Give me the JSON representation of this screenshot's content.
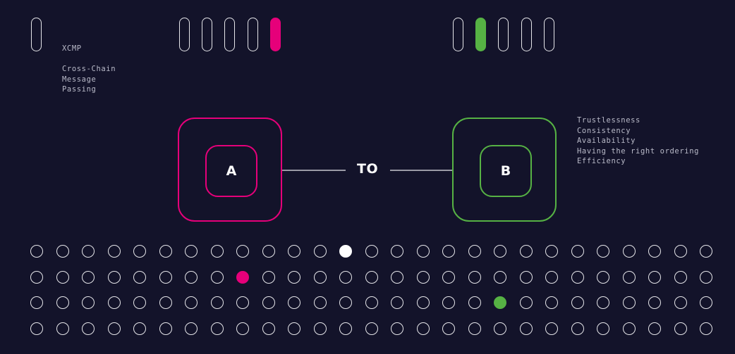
{
  "xcmp": {
    "title": "XCMP",
    "subtitle_lines": "Cross-Chain\nMessage\nPassing"
  },
  "properties": {
    "lines": "Trustlessness\nConsistency\nAvailability\nHaving the right ordering\nEfficiency"
  },
  "diagram": {
    "source_label": "A",
    "connector_label": "TO",
    "target_label": "B"
  },
  "pill_groups": {
    "left_single_count": 1,
    "source_group": {
      "count": 5,
      "highlighted_index": 4
    },
    "target_group": {
      "count": 5,
      "highlighted_index": 1
    }
  },
  "dot_grid": {
    "rows": 4,
    "columns": 27,
    "highlights": [
      {
        "row": 0,
        "col": 12,
        "color": "white"
      },
      {
        "row": 1,
        "col": 8,
        "color": "pink"
      },
      {
        "row": 2,
        "col": 18,
        "color": "green"
      }
    ]
  },
  "colors": {
    "background": "#13132a",
    "pink": "#e6007a",
    "green": "#56b244",
    "outline": "#e6e6ea"
  }
}
